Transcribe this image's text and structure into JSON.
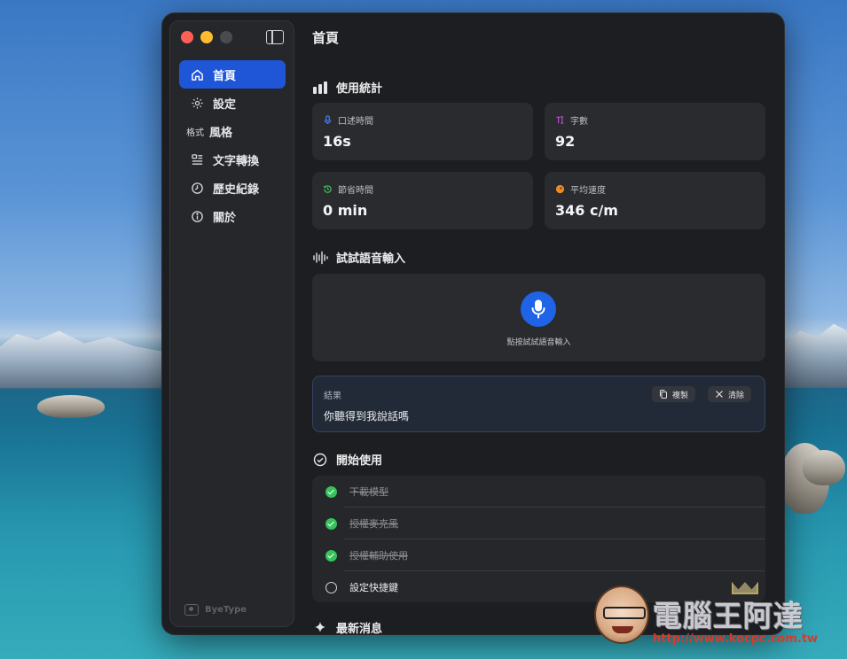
{
  "app": {
    "brand": "ByeType"
  },
  "sidebar": {
    "items": [
      {
        "id": "home",
        "label": "首頁",
        "icon": "home-icon",
        "active": true
      },
      {
        "id": "settings",
        "label": "設定",
        "icon": "gear-icon",
        "active": false
      },
      {
        "id": "style",
        "label": "風格",
        "icon_text": "格式",
        "active": false
      },
      {
        "id": "text-convert",
        "label": "文字轉換",
        "icon": "text-convert-icon",
        "active": false
      },
      {
        "id": "history",
        "label": "歷史紀錄",
        "icon": "clock-icon",
        "active": false
      },
      {
        "id": "about",
        "label": "關於",
        "icon": "info-icon",
        "active": false
      }
    ]
  },
  "main": {
    "title": "首頁",
    "stats": {
      "title": "使用統計",
      "cards": [
        {
          "label": "口述時間",
          "value": "16s",
          "icon": "mic-icon",
          "color": "#4d7ef0"
        },
        {
          "label": "字數",
          "value": "92",
          "icon": "text-count-icon",
          "color": "#c04bd8"
        },
        {
          "label": "節省時間",
          "value": "0 min",
          "icon": "history-icon",
          "color": "#3fbf5a"
        },
        {
          "label": "平均速度",
          "value": "346 c/m",
          "icon": "speed-icon",
          "color": "#f08a24"
        }
      ]
    },
    "voice": {
      "title": "試試語音輸入",
      "caption": "點按試試語音輸入"
    },
    "result": {
      "label": "結果",
      "text": "你聽得到我說話嗎",
      "copy_label": "複製",
      "clear_label": "清除"
    },
    "getting_started": {
      "title": "開始使用",
      "items": [
        {
          "label": "下載模型",
          "done": true
        },
        {
          "label": "授權麥克風",
          "done": true
        },
        {
          "label": "授權輔助使用",
          "done": true
        },
        {
          "label": "設定快捷鍵",
          "done": false
        }
      ]
    },
    "news": {
      "title": "最新消息"
    }
  },
  "watermark": {
    "title": "電腦王阿達",
    "url": "http://www.kocpc.com.tw"
  },
  "colors": {
    "accent": "#1f56d8",
    "mic_button": "#1f63e6",
    "check_done": "#35c35a"
  }
}
